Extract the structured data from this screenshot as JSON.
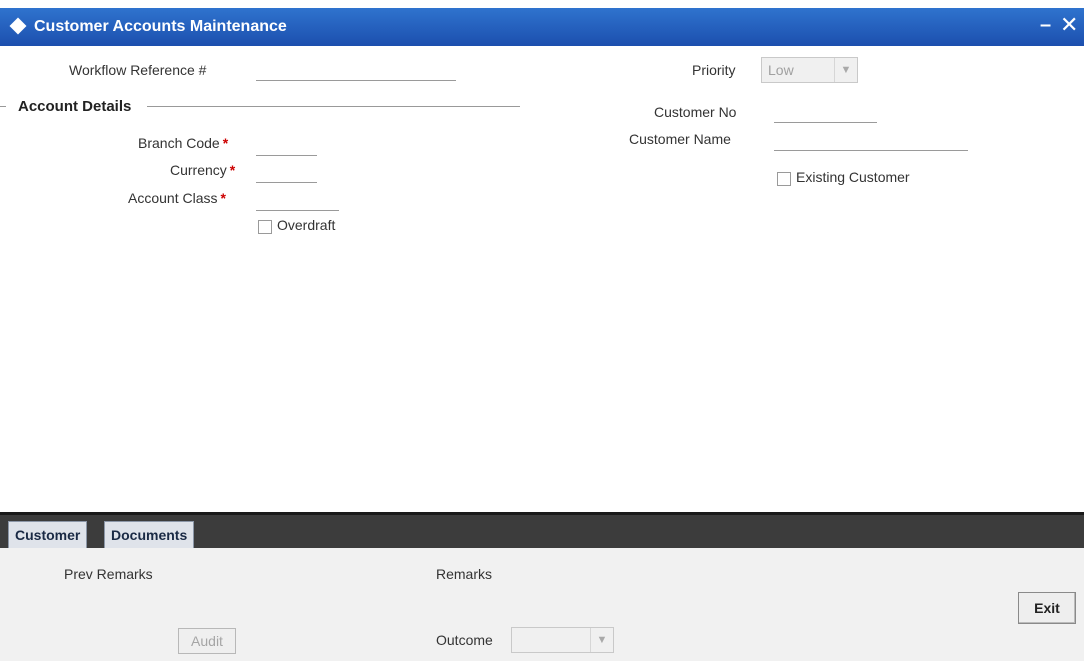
{
  "window": {
    "title": "Customer Accounts Maintenance",
    "minimize_glyph": "–",
    "close_glyph": "✕"
  },
  "form": {
    "workflow_reference_label": "Workflow Reference #",
    "workflow_reference_value": "",
    "priority_label": "Priority",
    "priority_value": "Low",
    "account_details_title": "Account Details",
    "branch_code_label": "Branch Code",
    "currency_label": "Currency",
    "account_class_label": "Account Class",
    "required_marker": "*",
    "overdraft_label": "Overdraft",
    "customer_no_label": "Customer No",
    "customer_name_label": "Customer Name",
    "existing_customer_label": "Existing Customer"
  },
  "tabs": [
    {
      "label": "Customer"
    },
    {
      "label": "Documents"
    }
  ],
  "footer": {
    "prev_remarks_label": "Prev Remarks",
    "remarks_label": "Remarks",
    "audit_button": "Audit",
    "outcome_label": "Outcome",
    "outcome_value": "",
    "exit_button": "Exit"
  },
  "icons": {
    "title_icon": "diamond-icon",
    "dropdown_arrow": "chevron-down-icon"
  },
  "colors": {
    "titlebar": "#1c4fae",
    "required": "#cc0000",
    "tabbar": "#3c3c3c"
  }
}
